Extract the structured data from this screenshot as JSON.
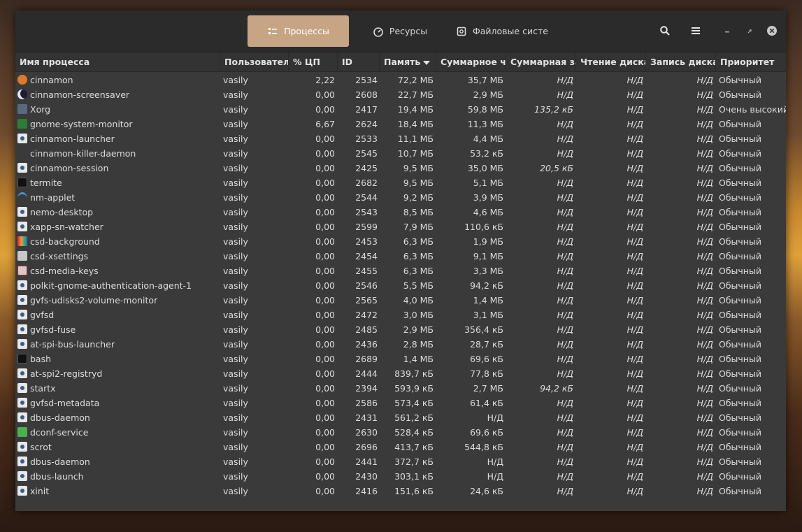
{
  "tabs": [
    {
      "label": "Процессы",
      "icon": "list-icon"
    },
    {
      "label": "Ресурсы",
      "icon": "gauge-icon"
    },
    {
      "label": "Файловые систе",
      "icon": "disk-icon"
    }
  ],
  "columns": {
    "name": "Имя процесса",
    "user": "Пользовател",
    "cpu": "% ЦП",
    "id": "ID",
    "memory": "Память",
    "read_total": "Суммарное чт",
    "write_total": "Суммарная за",
    "disk_read": "Чтение диска",
    "disk_write": "Запись диска",
    "priority": "Приоритет"
  },
  "processes": [
    {
      "name": "cinnamon",
      "icon": "cinnamon-icon",
      "user": "vasily",
      "cpu": "2,22",
      "id": "2534",
      "memory": "72,2 МБ",
      "read_total": "35,7 МБ",
      "write_total": "Н/Д",
      "disk_read": "Н/Д",
      "disk_write": "Н/Д",
      "priority": "Обычный"
    },
    {
      "name": "cinnamon-screensaver",
      "icon": "moon-icon",
      "user": "vasily",
      "cpu": "0,00",
      "id": "2608",
      "memory": "22,7 МБ",
      "read_total": "2,9 МБ",
      "write_total": "Н/Д",
      "disk_read": "Н/Д",
      "disk_write": "Н/Д",
      "priority": "Обычный"
    },
    {
      "name": "Xorg",
      "icon": "monitor-icon",
      "user": "vasily",
      "cpu": "0,00",
      "id": "2417",
      "memory": "19,4 МБ",
      "read_total": "59,8 МБ",
      "write_total": "135,2 кБ",
      "disk_read": "Н/Д",
      "disk_write": "Н/Д",
      "priority": "Очень высокий"
    },
    {
      "name": "gnome-system-monitor",
      "icon": "system-monitor-icon",
      "user": "vasily",
      "cpu": "6,67",
      "id": "2624",
      "memory": "18,4 МБ",
      "read_total": "11,3 МБ",
      "write_total": "Н/Д",
      "disk_read": "Н/Д",
      "disk_write": "Н/Д",
      "priority": "Обычный"
    },
    {
      "name": "cinnamon-launcher",
      "icon": "gear-icon",
      "user": "vasily",
      "cpu": "0,00",
      "id": "2533",
      "memory": "11,1 МБ",
      "read_total": "4,4 МБ",
      "write_total": "Н/Д",
      "disk_read": "Н/Д",
      "disk_write": "Н/Д",
      "priority": "Обычный"
    },
    {
      "name": "cinnamon-killer-daemon",
      "icon": "",
      "user": "vasily",
      "cpu": "0,00",
      "id": "2545",
      "memory": "10,7 МБ",
      "read_total": "53,2 кБ",
      "write_total": "Н/Д",
      "disk_read": "Н/Д",
      "disk_write": "Н/Д",
      "priority": "Обычный"
    },
    {
      "name": "cinnamon-session",
      "icon": "gear-icon",
      "user": "vasily",
      "cpu": "0,00",
      "id": "2425",
      "memory": "9,5 МБ",
      "read_total": "35,0 МБ",
      "write_total": "20,5 кБ",
      "disk_read": "Н/Д",
      "disk_write": "Н/Д",
      "priority": "Обычный"
    },
    {
      "name": "termite",
      "icon": "terminal-icon",
      "user": "vasily",
      "cpu": "0,00",
      "id": "2682",
      "memory": "9,5 МБ",
      "read_total": "5,1 МБ",
      "write_total": "Н/Д",
      "disk_read": "Н/Д",
      "disk_write": "Н/Д",
      "priority": "Обычный"
    },
    {
      "name": "nm-applet",
      "icon": "wifi-icon",
      "user": "vasily",
      "cpu": "0,00",
      "id": "2544",
      "memory": "9,2 МБ",
      "read_total": "3,9 МБ",
      "write_total": "Н/Д",
      "disk_read": "Н/Д",
      "disk_write": "Н/Д",
      "priority": "Обычный"
    },
    {
      "name": "nemo-desktop",
      "icon": "gear-icon",
      "user": "vasily",
      "cpu": "0,00",
      "id": "2543",
      "memory": "8,5 МБ",
      "read_total": "4,6 МБ",
      "write_total": "Н/Д",
      "disk_read": "Н/Д",
      "disk_write": "Н/Д",
      "priority": "Обычный"
    },
    {
      "name": "xapp-sn-watcher",
      "icon": "gear-icon",
      "user": "vasily",
      "cpu": "0,00",
      "id": "2599",
      "memory": "7,9 МБ",
      "read_total": "110,6 кБ",
      "write_total": "Н/Д",
      "disk_read": "Н/Д",
      "disk_write": "Н/Д",
      "priority": "Обычный"
    },
    {
      "name": "csd-background",
      "icon": "background-icon",
      "user": "vasily",
      "cpu": "0,00",
      "id": "2453",
      "memory": "6,3 МБ",
      "read_total": "1,9 МБ",
      "write_total": "Н/Д",
      "disk_read": "Н/Д",
      "disk_write": "Н/Д",
      "priority": "Обычный"
    },
    {
      "name": "csd-xsettings",
      "icon": "settings-icon",
      "user": "vasily",
      "cpu": "0,00",
      "id": "2454",
      "memory": "6,3 МБ",
      "read_total": "9,1 МБ",
      "write_total": "Н/Д",
      "disk_read": "Н/Д",
      "disk_write": "Н/Д",
      "priority": "Обычный"
    },
    {
      "name": "csd-media-keys",
      "icon": "keyboard-icon",
      "user": "vasily",
      "cpu": "0,00",
      "id": "2455",
      "memory": "6,3 МБ",
      "read_total": "3,3 МБ",
      "write_total": "Н/Д",
      "disk_read": "Н/Д",
      "disk_write": "Н/Д",
      "priority": "Обычный"
    },
    {
      "name": "polkit-gnome-authentication-agent-1",
      "icon": "gear-icon",
      "user": "vasily",
      "cpu": "0,00",
      "id": "2546",
      "memory": "5,5 МБ",
      "read_total": "94,2 кБ",
      "write_total": "Н/Д",
      "disk_read": "Н/Д",
      "disk_write": "Н/Д",
      "priority": "Обычный"
    },
    {
      "name": "gvfs-udisks2-volume-monitor",
      "icon": "gear-icon",
      "user": "vasily",
      "cpu": "0,00",
      "id": "2565",
      "memory": "4,0 МБ",
      "read_total": "1,4 МБ",
      "write_total": "Н/Д",
      "disk_read": "Н/Д",
      "disk_write": "Н/Д",
      "priority": "Обычный"
    },
    {
      "name": "gvfsd",
      "icon": "gear-icon",
      "user": "vasily",
      "cpu": "0,00",
      "id": "2472",
      "memory": "3,0 МБ",
      "read_total": "3,1 МБ",
      "write_total": "Н/Д",
      "disk_read": "Н/Д",
      "disk_write": "Н/Д",
      "priority": "Обычный"
    },
    {
      "name": "gvfsd-fuse",
      "icon": "gear-icon",
      "user": "vasily",
      "cpu": "0,00",
      "id": "2485",
      "memory": "2,9 МБ",
      "read_total": "356,4 кБ",
      "write_total": "Н/Д",
      "disk_read": "Н/Д",
      "disk_write": "Н/Д",
      "priority": "Обычный"
    },
    {
      "name": "at-spi-bus-launcher",
      "icon": "gear-icon",
      "user": "vasily",
      "cpu": "0,00",
      "id": "2436",
      "memory": "2,8 МБ",
      "read_total": "28,7 кБ",
      "write_total": "Н/Д",
      "disk_read": "Н/Д",
      "disk_write": "Н/Д",
      "priority": "Обычный"
    },
    {
      "name": "bash",
      "icon": "terminal-icon",
      "user": "vasily",
      "cpu": "0,00",
      "id": "2689",
      "memory": "1,4 МБ",
      "read_total": "69,6 кБ",
      "write_total": "Н/Д",
      "disk_read": "Н/Д",
      "disk_write": "Н/Д",
      "priority": "Обычный"
    },
    {
      "name": "at-spi2-registryd",
      "icon": "gear-icon",
      "user": "vasily",
      "cpu": "0,00",
      "id": "2444",
      "memory": "839,7 кБ",
      "read_total": "77,8 кБ",
      "write_total": "Н/Д",
      "disk_read": "Н/Д",
      "disk_write": "Н/Д",
      "priority": "Обычный"
    },
    {
      "name": "startx",
      "icon": "gear-icon",
      "user": "vasily",
      "cpu": "0,00",
      "id": "2394",
      "memory": "593,9 кБ",
      "read_total": "2,7 МБ",
      "write_total": "94,2 кБ",
      "disk_read": "Н/Д",
      "disk_write": "Н/Д",
      "priority": "Обычный"
    },
    {
      "name": "gvfsd-metadata",
      "icon": "gear-icon",
      "user": "vasily",
      "cpu": "0,00",
      "id": "2586",
      "memory": "573,4 кБ",
      "read_total": "61,4 кБ",
      "write_total": "Н/Д",
      "disk_read": "Н/Д",
      "disk_write": "Н/Д",
      "priority": "Обычный"
    },
    {
      "name": "dbus-daemon",
      "icon": "gear-icon",
      "user": "vasily",
      "cpu": "0,00",
      "id": "2431",
      "memory": "561,2 кБ",
      "read_total": "Н/Д",
      "write_total": "Н/Д",
      "disk_read": "Н/Д",
      "disk_write": "Н/Д",
      "priority": "Обычный"
    },
    {
      "name": "dconf-service",
      "icon": "dconf-icon",
      "user": "vasily",
      "cpu": "0,00",
      "id": "2630",
      "memory": "528,4 кБ",
      "read_total": "69,6 кБ",
      "write_total": "Н/Д",
      "disk_read": "Н/Д",
      "disk_write": "Н/Д",
      "priority": "Обычный"
    },
    {
      "name": "scrot",
      "icon": "gear-icon",
      "user": "vasily",
      "cpu": "0,00",
      "id": "2696",
      "memory": "413,7 кБ",
      "read_total": "544,8 кБ",
      "write_total": "Н/Д",
      "disk_read": "Н/Д",
      "disk_write": "Н/Д",
      "priority": "Обычный"
    },
    {
      "name": "dbus-daemon",
      "icon": "gear-icon",
      "user": "vasily",
      "cpu": "0,00",
      "id": "2441",
      "memory": "372,7 кБ",
      "read_total": "Н/Д",
      "write_total": "Н/Д",
      "disk_read": "Н/Д",
      "disk_write": "Н/Д",
      "priority": "Обычный"
    },
    {
      "name": "dbus-launch",
      "icon": "gear-icon",
      "user": "vasily",
      "cpu": "0,00",
      "id": "2430",
      "memory": "303,1 кБ",
      "read_total": "Н/Д",
      "write_total": "Н/Д",
      "disk_read": "Н/Д",
      "disk_write": "Н/Д",
      "priority": "Обычный"
    },
    {
      "name": "xinit",
      "icon": "gear-icon",
      "user": "vasily",
      "cpu": "0,00",
      "id": "2416",
      "memory": "151,6 кБ",
      "read_total": "24,6 кБ",
      "write_total": "Н/Д",
      "disk_read": "Н/Д",
      "disk_write": "Н/Д",
      "priority": "Обычный"
    }
  ]
}
